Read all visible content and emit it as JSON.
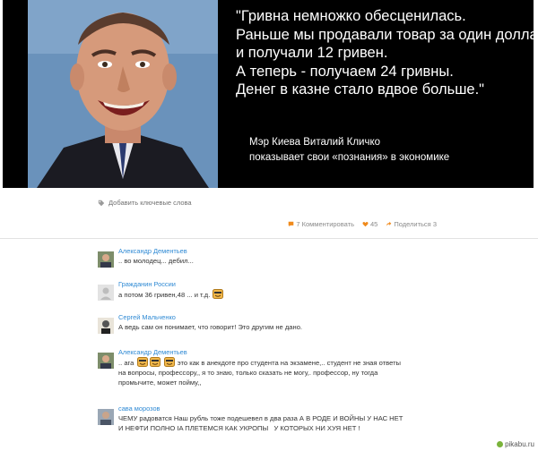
{
  "banner": {
    "quote_lines": [
      "\"Гривна немножко обесценилась.",
      "Раньше мы продавали товар за один доллар",
      "и получали 12 гривен.",
      "А теперь - получаем 24 гривны.",
      "Денег в казне стало вдвое больше.\""
    ],
    "caption_lines": [
      "Мэр Киева Виталий Кличко",
      "показывает свои «познания» в экономике"
    ]
  },
  "post": {
    "tags_label": "Добавить ключевые слова",
    "comments_label": "7 Комментировать",
    "rating": "45",
    "share_label": "Поделиться 3"
  },
  "comments": [
    {
      "author": "Александр Дементьев",
      "text": ".. во молодец... дебил...",
      "avatar_icon": "user-photo"
    },
    {
      "author": "Гражданин России",
      "text_before": "а потом 36 гривен,48 ... и т.д.",
      "smile_count": 1,
      "avatar_icon": "default-avatar"
    },
    {
      "author": "Сергей Мальченко",
      "text": "А ведь сам он понимает, что говорит! Это другим не дано.",
      "avatar_icon": "user-photo"
    },
    {
      "author": "Александр Дементьев",
      "text_before": ".. ага",
      "text_after": "это как в анекдоте про студента на экзамене,.. студент не зная ответы",
      "text_line2": "на вопросы, профессору,, я то знаю, только сказать не могу,. профессор, ну тогда",
      "text_line3": "промычите, может пойму,,",
      "smile_count": 3,
      "avatar_icon": "user-photo"
    },
    {
      "author": "сава морозов",
      "text_line1": "ЧЕМУ радоватся Наш рубль тоже подешевел в два раза А В РОДЕ И ВОЙНЫ У НАС НЕТ",
      "text_line2": "И НЕФТИ ПОЛНО IA ПЛЕТЕМСЯ КАК УКРОПЫ   У КОТОРЫХ НИ ХУЯ НЕТ !",
      "avatar_icon": "user-photo"
    }
  ],
  "watermark": "pikabu.ru",
  "colors": {
    "link": "#2f8ad4",
    "accent_orange": "#f08a1c",
    "banner_bg": "#000000"
  }
}
